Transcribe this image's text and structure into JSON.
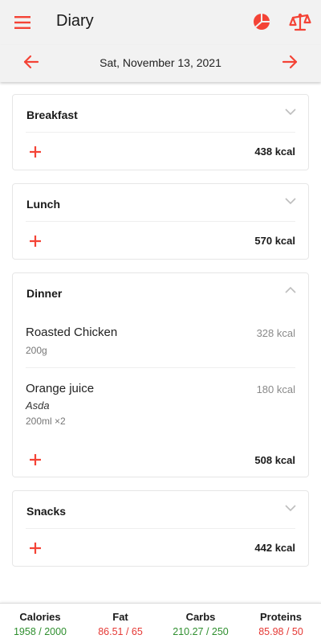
{
  "colors": {
    "accent": "#f44336",
    "ok": "#2f8f2f",
    "over": "#e53935"
  },
  "appbar": {
    "title": "Diary",
    "menu_icon": "menu-icon",
    "pie_icon": "pie-chart-icon",
    "scale_icon": "scale-icon"
  },
  "datebar": {
    "date": "Sat, November 13, 2021",
    "prev_icon": "arrow-left-icon",
    "next_icon": "arrow-right-icon"
  },
  "meals": {
    "breakfast": {
      "title": "Breakfast",
      "total": "438 kcal",
      "expanded": false
    },
    "lunch": {
      "title": "Lunch",
      "total": "570 kcal",
      "expanded": false
    },
    "dinner": {
      "title": "Dinner",
      "total": "508 kcal",
      "expanded": true,
      "entries": [
        {
          "name": "Roasted Chicken",
          "kcal": "328 kcal",
          "amount": "200g"
        },
        {
          "name": "Orange juice",
          "kcal": "180 kcal",
          "brand": "Asda",
          "amount": "200ml ×2"
        }
      ]
    },
    "snacks": {
      "title": "Snacks",
      "total": "442 kcal",
      "expanded": false
    }
  },
  "summary": {
    "calories": {
      "label": "Calories",
      "value": "1958 / 2000",
      "status": "ok"
    },
    "fat": {
      "label": "Fat",
      "value": "86.51 / 65",
      "status": "over"
    },
    "carbs": {
      "label": "Carbs",
      "value": "210.27 / 250",
      "status": "ok"
    },
    "proteins": {
      "label": "Proteins",
      "value": "85.98 / 50",
      "status": "over"
    }
  }
}
